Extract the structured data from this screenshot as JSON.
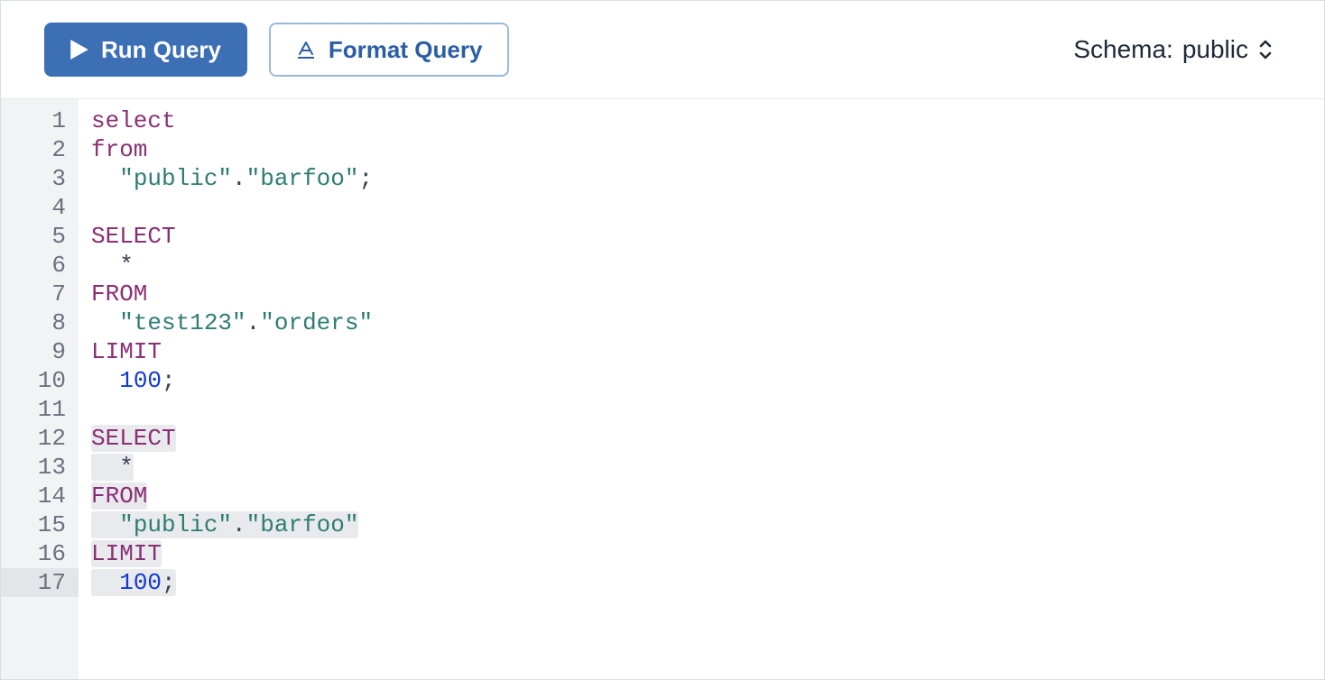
{
  "toolbar": {
    "run_label": "Run Query",
    "format_label": "Format Query",
    "schema_label_prefix": "Schema: ",
    "schema_value": "public"
  },
  "editor": {
    "line_count": 17,
    "current_line": 17,
    "lines": [
      {
        "n": 1,
        "tokens": [
          {
            "t": "select",
            "c": "kw"
          }
        ]
      },
      {
        "n": 2,
        "tokens": [
          {
            "t": "from",
            "c": "kw"
          }
        ]
      },
      {
        "n": 3,
        "tokens": [
          {
            "t": "  ",
            "c": ""
          },
          {
            "t": "\"public\"",
            "c": "str"
          },
          {
            "t": ".",
            "c": "punct"
          },
          {
            "t": "\"barfoo\"",
            "c": "str"
          },
          {
            "t": ";",
            "c": "punct"
          }
        ]
      },
      {
        "n": 4,
        "tokens": []
      },
      {
        "n": 5,
        "tokens": [
          {
            "t": "SELECT",
            "c": "kw"
          }
        ]
      },
      {
        "n": 6,
        "tokens": [
          {
            "t": "  *",
            "c": "op"
          }
        ]
      },
      {
        "n": 7,
        "tokens": [
          {
            "t": "FROM",
            "c": "kw"
          }
        ]
      },
      {
        "n": 8,
        "tokens": [
          {
            "t": "  ",
            "c": ""
          },
          {
            "t": "\"test123\"",
            "c": "str"
          },
          {
            "t": ".",
            "c": "punct"
          },
          {
            "t": "\"orders\"",
            "c": "str"
          }
        ]
      },
      {
        "n": 9,
        "tokens": [
          {
            "t": "LIMIT",
            "c": "kw"
          }
        ]
      },
      {
        "n": 10,
        "tokens": [
          {
            "t": "  ",
            "c": ""
          },
          {
            "t": "100",
            "c": "num"
          },
          {
            "t": ";",
            "c": "punct"
          }
        ]
      },
      {
        "n": 11,
        "tokens": []
      },
      {
        "n": 12,
        "hl": true,
        "tokens": [
          {
            "t": "SELECT",
            "c": "kw"
          }
        ]
      },
      {
        "n": 13,
        "hl": true,
        "tokens": [
          {
            "t": "  *",
            "c": "op"
          }
        ]
      },
      {
        "n": 14,
        "hl": true,
        "tokens": [
          {
            "t": "FROM",
            "c": "kw"
          }
        ]
      },
      {
        "n": 15,
        "hl": true,
        "tokens": [
          {
            "t": "  ",
            "c": ""
          },
          {
            "t": "\"public\"",
            "c": "str"
          },
          {
            "t": ".",
            "c": "punct"
          },
          {
            "t": "\"barfoo\"",
            "c": "str"
          }
        ]
      },
      {
        "n": 16,
        "hl": true,
        "tokens": [
          {
            "t": "LIMIT",
            "c": "kw"
          }
        ]
      },
      {
        "n": 17,
        "hl": true,
        "tokens": [
          {
            "t": "  ",
            "c": ""
          },
          {
            "t": "100",
            "c": "num"
          },
          {
            "t": ";",
            "c": "punct"
          }
        ]
      }
    ]
  }
}
